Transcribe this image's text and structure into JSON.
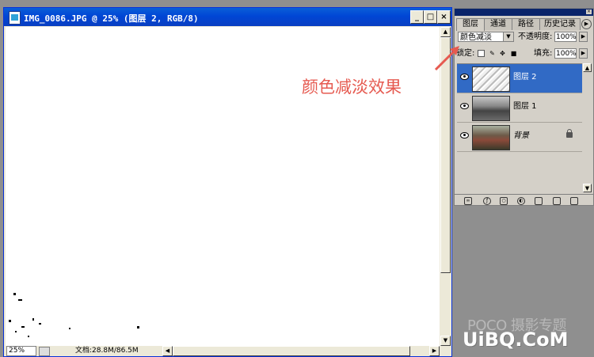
{
  "document": {
    "title": "IMG_0086.JPG @ 25% (图层 2, RGB/8)",
    "minimize_glyph": "_",
    "maximize_glyph": "□",
    "close_glyph": "×",
    "zoom": "25%",
    "doc_info": "文档:28.8M/86.5M"
  },
  "layers_palette": {
    "tabs": [
      "图层",
      "通道",
      "路径",
      "历史记录"
    ],
    "blend_mode": "颜色减淡",
    "opacity_label": "不透明度:",
    "opacity_value": "100%",
    "lock_label": "锁定:",
    "fill_label": "填充:",
    "fill_value": "100%",
    "layers": [
      {
        "name": "图层 2",
        "selected": true
      },
      {
        "name": "图层 1",
        "selected": false
      },
      {
        "name": "背景",
        "selected": false,
        "locked": true
      }
    ]
  },
  "annotation": "颜色减淡效果",
  "watermark": {
    "line1": "POCO 摄影专题",
    "line2": "UiBQ.CoM"
  },
  "colors": {
    "title_bar": "#0046d5",
    "selected_layer": "#316ac5",
    "annotation": "#e65a50"
  }
}
